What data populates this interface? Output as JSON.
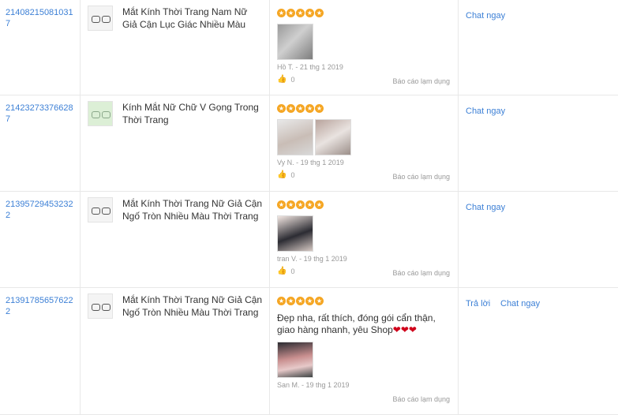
{
  "rows": [
    {
      "order_id": "214082150810317",
      "product": "Mắt Kính Thời Trang Nam Nữ Giả Cận Lục Giác Nhiều Màu",
      "rating": 5,
      "comment": "",
      "photos": [
        "glasses-photo"
      ],
      "reviewer": "Hồ T. - 21 thg 1 2019",
      "likes": "0",
      "report": "Báo cáo lạm dụng",
      "actions": [
        "Chat ngay"
      ]
    },
    {
      "order_id": "214232733766287",
      "product": "Kính Mắt Nữ Chữ V Gọng Trong Thời Trang",
      "rating": 5,
      "comment": "",
      "photos": [
        "hand-photo",
        "package-photo"
      ],
      "reviewer": "Vy N. - 19 thg 1 2019",
      "likes": "0",
      "report": "Báo cáo lạm dụng",
      "actions": [
        "Chat ngay"
      ]
    },
    {
      "order_id": "213957294532322",
      "product": "Mắt Kính Thời Trang Nữ Giả Cận Ngố Tròn Nhiều Màu Thời Trang",
      "rating": 5,
      "comment": "",
      "photos": [
        "portrait-photo"
      ],
      "reviewer": "tran V. - 19 thg 1 2019",
      "likes": "0",
      "report": "Báo cáo lạm dụng",
      "actions": [
        "Chat ngay"
      ]
    },
    {
      "order_id": "213917856576222",
      "product": "Mắt Kính Thời Trang Nữ Giả Cận Ngố Tròn Nhiều Màu Thời Trang",
      "rating": 5,
      "comment": "Đẹp nha, rất thích, đóng gói cẩn thận, giao hàng nhanh, yêu Shop",
      "comment_hearts": 3,
      "photos": [
        "selfie-photo"
      ],
      "reviewer": "San M. - 19 thg 1 2019",
      "likes": "0",
      "report": "Báo cáo lạm dụng",
      "actions": [
        "Trả lời",
        "Chat ngay"
      ]
    }
  ],
  "colors": {
    "link": "#3d80d6",
    "star": "#f5a623",
    "heart": "#d0021b",
    "muted": "#999999"
  },
  "icons": {
    "star": "star-icon",
    "like": "thumbs-up-icon",
    "heart": "heart-icon"
  }
}
